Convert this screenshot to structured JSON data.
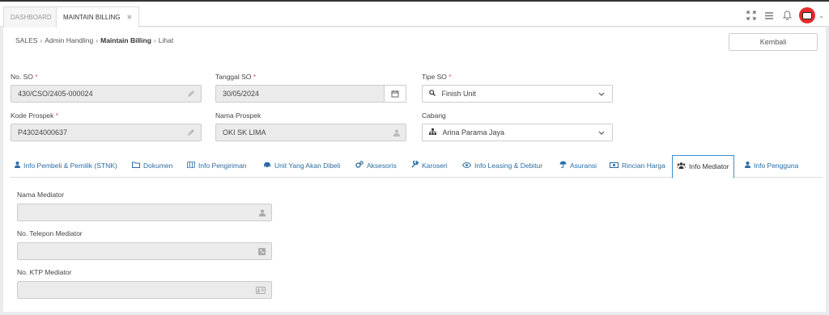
{
  "topbar": {
    "tabs": [
      {
        "label": "DASHBOARD"
      },
      {
        "label": "MAINTAIN BILLING",
        "close": "✖"
      }
    ],
    "icons": [
      "expand-icon",
      "menu-icon",
      "bell-icon",
      "avatar"
    ]
  },
  "breadcrumb": {
    "items": [
      "SALES",
      "Admin Handling",
      "Maintain Billing",
      "Lihat"
    ]
  },
  "actions": {
    "back_label": "Kembali"
  },
  "form": {
    "no_so": {
      "label": "No. SO",
      "req": "*",
      "value": "430/CSO/2405-000024"
    },
    "tanggal_so": {
      "label": "Tanggal SO",
      "req": "*",
      "value": "30/05/2024"
    },
    "tipe_so": {
      "label": "Tipe SO",
      "req": "*",
      "value": "Finish Unit"
    },
    "kode_prospek": {
      "label": "Kode Prospek",
      "req": "*",
      "value": "P43024000637"
    },
    "nama_prospek": {
      "label": "Nama Prospek",
      "value": "OKI SK LIMA"
    },
    "cabang": {
      "label": "Cabang",
      "value": "Arina Parama Jaya"
    }
  },
  "tabs": [
    {
      "label": "Info Pembeli & Pemilik (STNK)",
      "icon": "user-icon"
    },
    {
      "label": "Dokumen",
      "icon": "folder-icon"
    },
    {
      "label": "Info Pengiriman",
      "icon": "map-icon"
    },
    {
      "label": "Unit Yang Akan Dibeli",
      "icon": "car-icon"
    },
    {
      "label": "Aksesoris",
      "icon": "gears-icon"
    },
    {
      "label": "Karoseri",
      "icon": "wrench-icon"
    },
    {
      "label": "Info Leasing & Debitur",
      "icon": "eye-icon"
    },
    {
      "label": "Asuransi",
      "icon": "umbrella-icon"
    },
    {
      "label": "Rincian Harga",
      "icon": "money-icon"
    },
    {
      "label": "Info Mediator",
      "icon": "users-icon"
    },
    {
      "label": "Info Pengguna",
      "icon": "user-icon"
    }
  ],
  "mediator": {
    "nama": {
      "label": "Nama Mediator",
      "value": ""
    },
    "telepon": {
      "label": "No. Telepon Mediator",
      "value": ""
    },
    "ktp": {
      "label": "No. KTP Mediator",
      "value": ""
    }
  },
  "colors": {
    "accent": "#2b6ca3",
    "active_border": "#3a8ed0",
    "required": "#d9534f",
    "avatar": "#e52b2b"
  }
}
